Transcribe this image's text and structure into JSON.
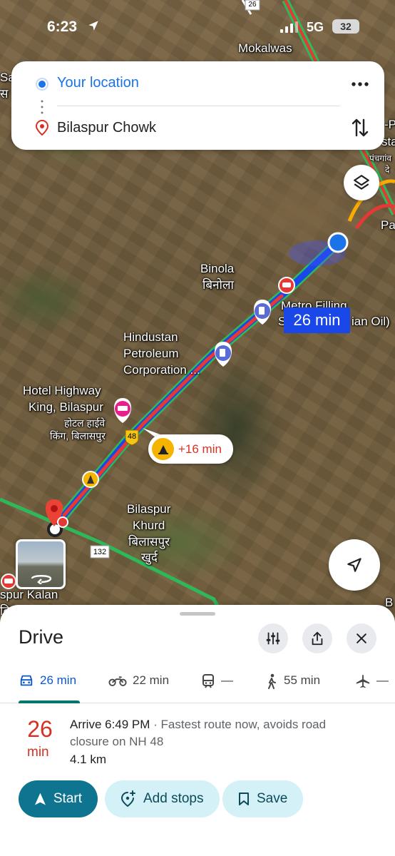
{
  "status_bar": {
    "time": "6:23",
    "network": "5G",
    "battery": "32"
  },
  "directions": {
    "origin": "Your location",
    "destination": "Bilaspur Chowk"
  },
  "map": {
    "labels": {
      "mokalwas": "Mokalwas",
      "binola": "Binola",
      "binola_hi": "बिनोला",
      "metro_filling": "Metro Filling",
      "metro_filling_2": "S",
      "metro_filling_3": "ian Oil)",
      "hindustan": "Hindustan",
      "petroleum": "Petroleum",
      "corporation": "Corporation ...",
      "hotel_1": "Hotel Highway",
      "hotel_2": "King, Bilaspur",
      "hotel_3": "होटल हाईवे",
      "hotel_4": "किंग, बिलासपुर",
      "bilaspur_khurd_1": "Bilaspur",
      "bilaspur_khurd_2": "Khurd",
      "bilaspur_khurd_3": "बिलासपुर",
      "bilaspur_khurd_4": "खुर्द",
      "bilaspur_kalan": "spur Kalan",
      "edge_left_1": "Sai",
      "edge_left_2": "स",
      "edge_right_1": "Pa",
      "edge_right_2": "B",
      "edge_right_3": "-P",
      "edge_right_4": "sta",
      "edge_right_5": "पंचगांव",
      "edge_right_6": "दे",
      "edge_bottom_left": "बि",
      "highway_48": "48",
      "highway_132": "132",
      "highway_26": "26"
    },
    "eta": "26 min",
    "delay": "+16 min",
    "colors": {
      "route_blue": "#1a47e8",
      "traffic_red": "#e53935",
      "traffic_green": "#2fb85a"
    }
  },
  "sheet": {
    "title": "Drive",
    "modes": [
      {
        "name": "drive",
        "icon": "car-icon",
        "label": "26 min",
        "active": true
      },
      {
        "name": "motorcycle",
        "icon": "motorcycle-icon",
        "label": "22 min"
      },
      {
        "name": "transit",
        "icon": "train-icon",
        "label": "—"
      },
      {
        "name": "walk",
        "icon": "walking-icon",
        "label": "55 min"
      },
      {
        "name": "flight",
        "icon": "plane-icon",
        "label": "—"
      }
    ],
    "route": {
      "minutes": "26",
      "minutes_unit": "min",
      "arrive": "Arrive 6:49 PM",
      "separator": " · ",
      "description": "Fastest route now, avoids road closure on NH 48",
      "distance": "4.1 km"
    },
    "actions": {
      "start": "Start",
      "add_stops": "Add stops",
      "save": "Save"
    }
  }
}
